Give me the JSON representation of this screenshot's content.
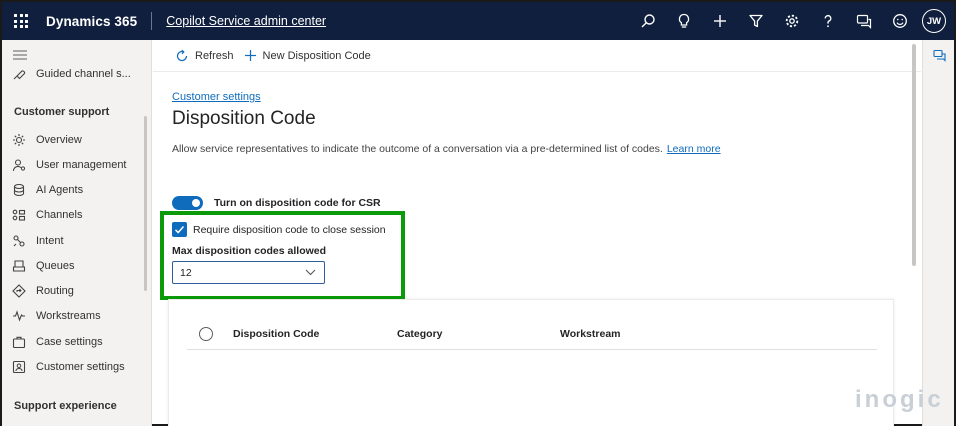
{
  "topbar": {
    "brand": "Dynamics 365",
    "app_name": "Copilot Service admin center",
    "user_initials": "JW",
    "icons": [
      "search-icon",
      "lightbulb-icon",
      "plus-icon",
      "filter-icon",
      "gear-icon",
      "help-icon",
      "chat-icon",
      "smiley-icon"
    ]
  },
  "sidebar": {
    "top_item": "Guided channel s...",
    "section1": "Customer support",
    "items": [
      {
        "label": "Overview",
        "icon": "overview-icon"
      },
      {
        "label": "User management",
        "icon": "user-management-icon"
      },
      {
        "label": "AI Agents",
        "icon": "ai-agents-icon"
      },
      {
        "label": "Channels",
        "icon": "channels-icon"
      },
      {
        "label": "Intent",
        "icon": "intent-icon"
      },
      {
        "label": "Queues",
        "icon": "queues-icon"
      },
      {
        "label": "Routing",
        "icon": "routing-icon"
      },
      {
        "label": "Workstreams",
        "icon": "workstreams-icon"
      },
      {
        "label": "Case settings",
        "icon": "case-settings-icon"
      },
      {
        "label": "Customer settings",
        "icon": "customer-settings-icon"
      }
    ],
    "section2": "Support experience"
  },
  "commandbar": {
    "refresh": "Refresh",
    "new_code": "New Disposition Code"
  },
  "main": {
    "breadcrumb": "Customer settings",
    "title": "Disposition Code",
    "description": "Allow service representatives to indicate the outcome of a conversation via a pre-determined list of codes.",
    "learn_more": "Learn more",
    "toggle_label": "Turn on disposition code for CSR",
    "checkbox_label": "Require disposition code to close session",
    "max_label": "Max disposition codes allowed",
    "max_value": "12"
  },
  "grid": {
    "columns": [
      "Disposition Code",
      "Category",
      "Workstream"
    ]
  },
  "watermark": "inogic",
  "colors": {
    "topbar": "#0f1f3d",
    "accent": "#0f6cbd",
    "highlight": "#0a9a0a"
  }
}
